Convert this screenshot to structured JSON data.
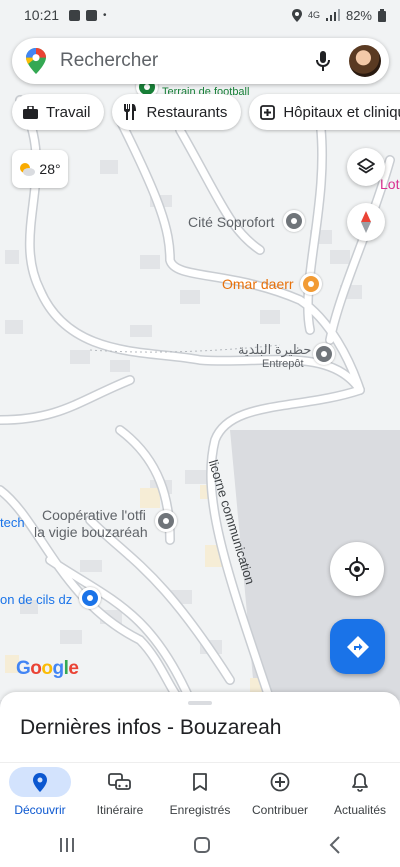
{
  "status_bar": {
    "time": "10:21",
    "network": "4G",
    "battery": "82%"
  },
  "search": {
    "placeholder": "Rechercher"
  },
  "chips": [
    {
      "label": "Travail",
      "icon": "briefcase-icon"
    },
    {
      "label": "Restaurants",
      "icon": "fork-knife-icon"
    },
    {
      "label": "Hôpitaux et cliniques",
      "icon": "hospital-icon"
    }
  ],
  "weather": {
    "temperature": "28°",
    "icon": "partly-sunny-icon"
  },
  "map": {
    "pois": [
      {
        "label": "Terrain de football",
        "color": "#188038"
      },
      {
        "label": "Lot",
        "color": "#d93090"
      },
      {
        "label": "Cité Soprofort",
        "color": "#70757a"
      },
      {
        "label": "Omar daerr",
        "color": "#e8710a"
      },
      {
        "label": "حظيرة البلدية",
        "color": "#70757a"
      },
      {
        "label": "Entrepôt",
        "color": "#70757a"
      },
      {
        "label": "Coopérative l'otfi",
        "color": "#70757a"
      },
      {
        "label": "la vigie bouzaréah",
        "color": "#70757a"
      },
      {
        "label": "tech",
        "color": "#1a73e8"
      },
      {
        "label": "on de cils dz",
        "color": "#1a73e8"
      }
    ],
    "road_label": "licorne communication",
    "logo": "Google"
  },
  "sheet": {
    "title": "Dernières infos - Bouzareah"
  },
  "bottom_nav": [
    {
      "label": "Découvrir",
      "icon": "explore-pin-icon",
      "active": true
    },
    {
      "label": "Itinéraire",
      "icon": "commute-icon",
      "active": false
    },
    {
      "label": "Enregistrés",
      "icon": "bookmark-icon",
      "active": false
    },
    {
      "label": "Contribuer",
      "icon": "add-circle-icon",
      "active": false
    },
    {
      "label": "Actualités",
      "icon": "bell-icon",
      "active": false
    }
  ],
  "colors": {
    "accent": "#1a73e8",
    "active_nav": "#0b57d0",
    "map_bg": "#f1f3f4"
  }
}
